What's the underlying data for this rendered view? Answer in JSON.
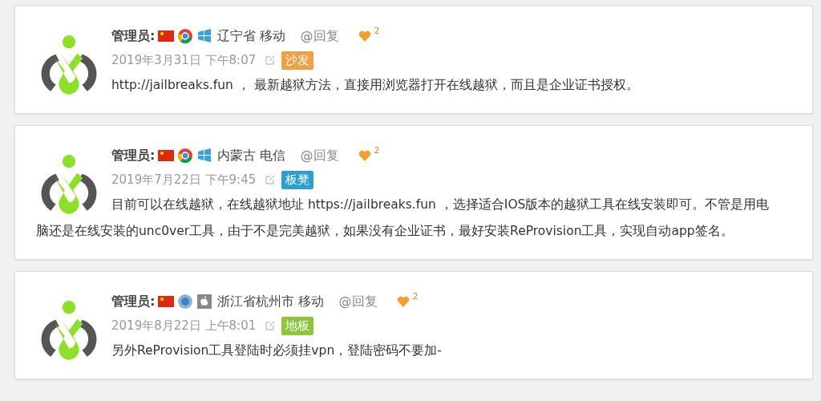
{
  "comments": [
    {
      "author": "管理员:",
      "icons": [
        {
          "kind": "flag"
        },
        {
          "kind": "chrome"
        },
        {
          "kind": "windows"
        }
      ],
      "location": "辽宁省 移动",
      "reply": "@回复",
      "likes": "2",
      "date": "2019年3月31日 下午8:07",
      "badge": {
        "label": "沙发",
        "color": "#f0a043"
      },
      "content": "http://jailbreaks.fun ， 最新越狱方法，直接用浏览器打开在线越狱，而且是企业证书授权。"
    },
    {
      "author": "管理员:",
      "icons": [
        {
          "kind": "flag"
        },
        {
          "kind": "chrome"
        },
        {
          "kind": "windows"
        }
      ],
      "location": "内蒙古 电信",
      "reply": "@回复",
      "likes": "2",
      "date": "2019年7月22日 下午9:45",
      "badge": {
        "label": "板凳",
        "color": "#2b9fcf"
      },
      "content": "目前可以在线越狱，在线越狱地址 https://jailbreaks.fun ，选择适合IOS版本的越狱工具在线安装即可。不管是用电脑还是在线安装的unc0ver工具，由于不是完美越狱，如果没有企业证书，最好安装ReProvision工具，实现自动app签名。"
    },
    {
      "author": "管理员:",
      "icons": [
        {
          "kind": "flag"
        },
        {
          "kind": "globe"
        },
        {
          "kind": "apple"
        }
      ],
      "location": "浙江省杭州市 移动",
      "reply": "@回复",
      "likes": "2",
      "date": "2019年8月22日 上午8:01",
      "badge": {
        "label": "地板",
        "color": "#8cc63f"
      },
      "content": "另外ReProvision工具登陆时必须挂vpn，登陆密码不要加-"
    }
  ]
}
